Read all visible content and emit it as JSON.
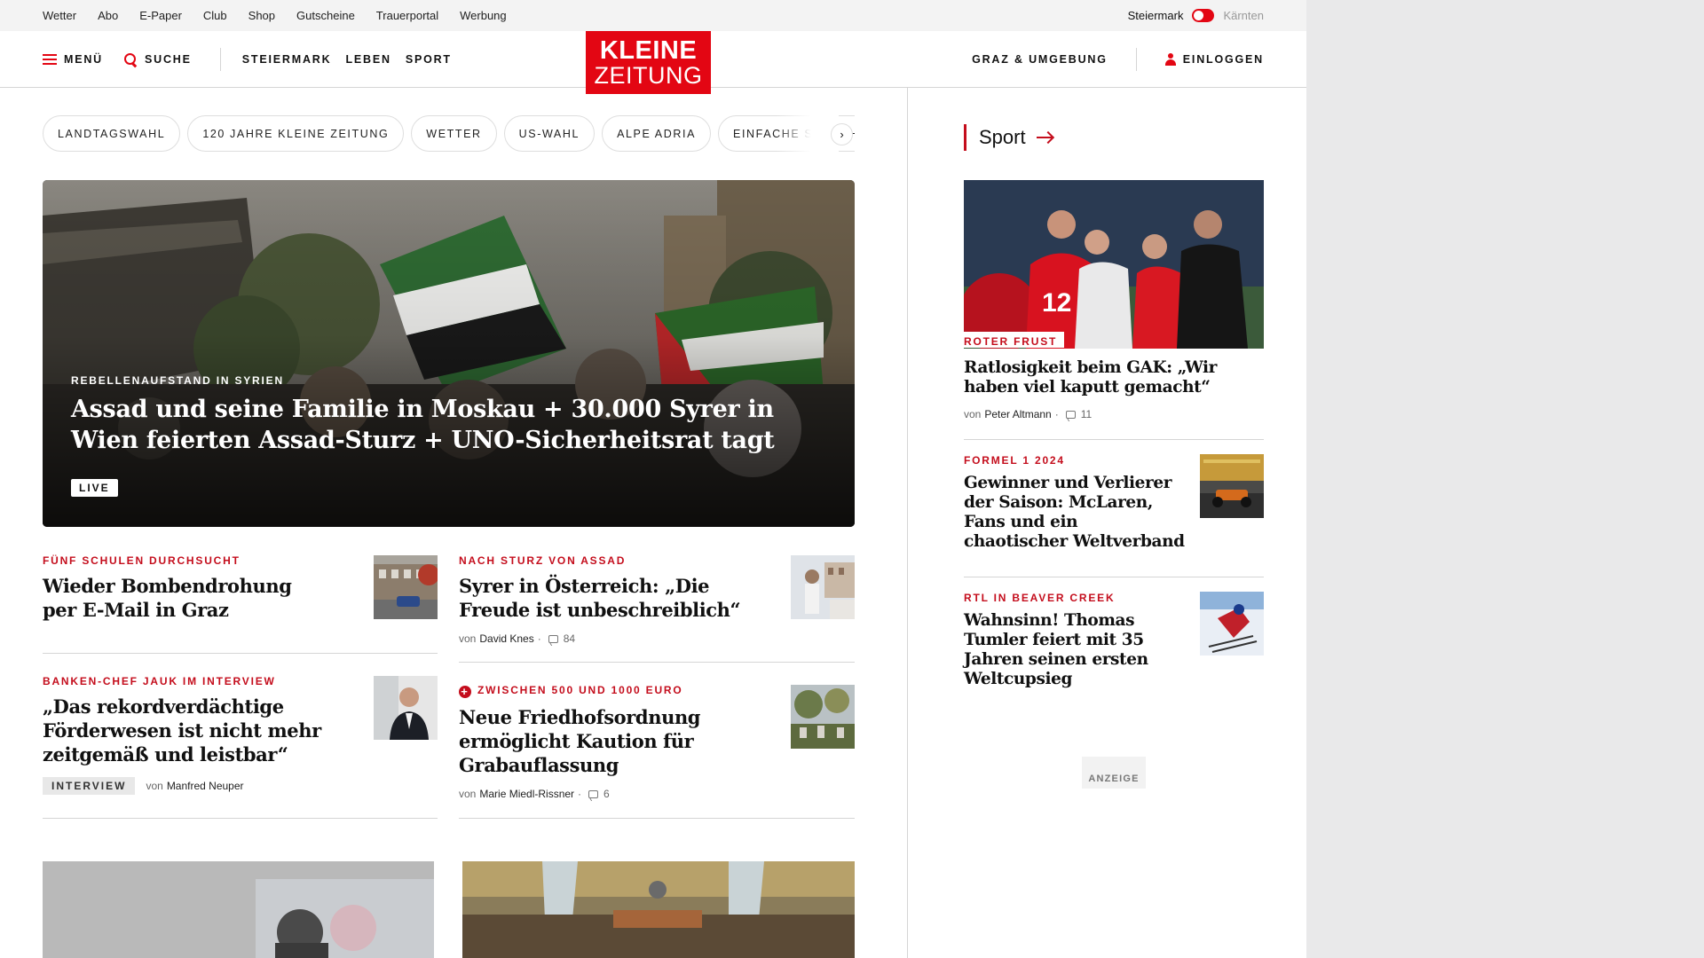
{
  "topbar": {
    "links": [
      "Wetter",
      "Abo",
      "E-Paper",
      "Club",
      "Shop",
      "Gutscheine",
      "Trauerportal",
      "Werbung"
    ],
    "region_active": "Steiermark",
    "region_inactive": "Kärnten"
  },
  "header": {
    "menu": "MENÜ",
    "search": "SUCHE",
    "nav": [
      "STEIERMARK",
      "LEBEN",
      "SPORT"
    ],
    "logo_line1": "KLEINE",
    "logo_line2": "ZEITUNG",
    "local": "GRAZ & UMGEBUNG",
    "login": "EINLOGGEN"
  },
  "chips": [
    "LANDTAGSWAHL",
    "120 JAHRE KLEINE ZEITUNG",
    "WETTER",
    "US-WAHL",
    "ALPE ADRIA",
    "EINFACHE SPRACHE"
  ],
  "chip_next": "›",
  "hero": {
    "kicker": "REBELLENAUFSTAND IN SYRIEN",
    "title": "Assad und seine Familie in Moskau + 30.000 Syrer in Wien feierten Assad-Sturz + UNO-Sicherheitsrat tagt",
    "badge": "LIVE"
  },
  "articles": {
    "a1": {
      "kicker": "FÜNF SCHULEN DURCHSUCHT",
      "title": "Wieder Bombendrohung per E-Mail in Graz"
    },
    "a2": {
      "kicker": "NACH STURZ VON ASSAD",
      "title": "Syrer in Österreich: „Die Freude ist unbeschreiblich“",
      "by": "von",
      "author": "David Knes",
      "sep": "·",
      "comments": "84"
    },
    "a3": {
      "kicker": "BANKEN-CHEF JAUK IM INTERVIEW",
      "title": "„Das rekordverdächtige Förderwesen ist nicht mehr zeitgemäß und leistbar“",
      "badge": "INTERVIEW",
      "by": "von",
      "author": "Manfred Neuper"
    },
    "a4": {
      "kicker": "ZWISCHEN 500 UND 1000 EURO",
      "title": "Neue Friedhofsordnung ermöglicht Kaution für Grabauflassung",
      "by": "von",
      "author": "Marie Miedl-Rissner",
      "sep": "·",
      "comments": "6"
    }
  },
  "sidebar": {
    "heading": "Sport",
    "s1": {
      "kicker": "ROTER FRUST",
      "title": "Ratlosigkeit beim GAK: „Wir haben viel kaputt gemacht“",
      "by": "von",
      "author": "Peter Altmann",
      "sep": "·",
      "comments": "11"
    },
    "s2": {
      "kicker": "FORMEL 1 2024",
      "title": "Gewinner und Verlierer der Saison: McLaren, Fans und ein chaotischer Weltverband"
    },
    "s3": {
      "kicker": "RTL IN BEAVER CREEK",
      "title": "Wahnsinn! Thomas Tumler feiert mit 35 Jahren seinen ersten Weltcupsieg"
    },
    "ad_label": "ANZEIGE"
  },
  "colors": {
    "brand_red": "#e30613",
    "kicker_red": "#c40d1c"
  }
}
